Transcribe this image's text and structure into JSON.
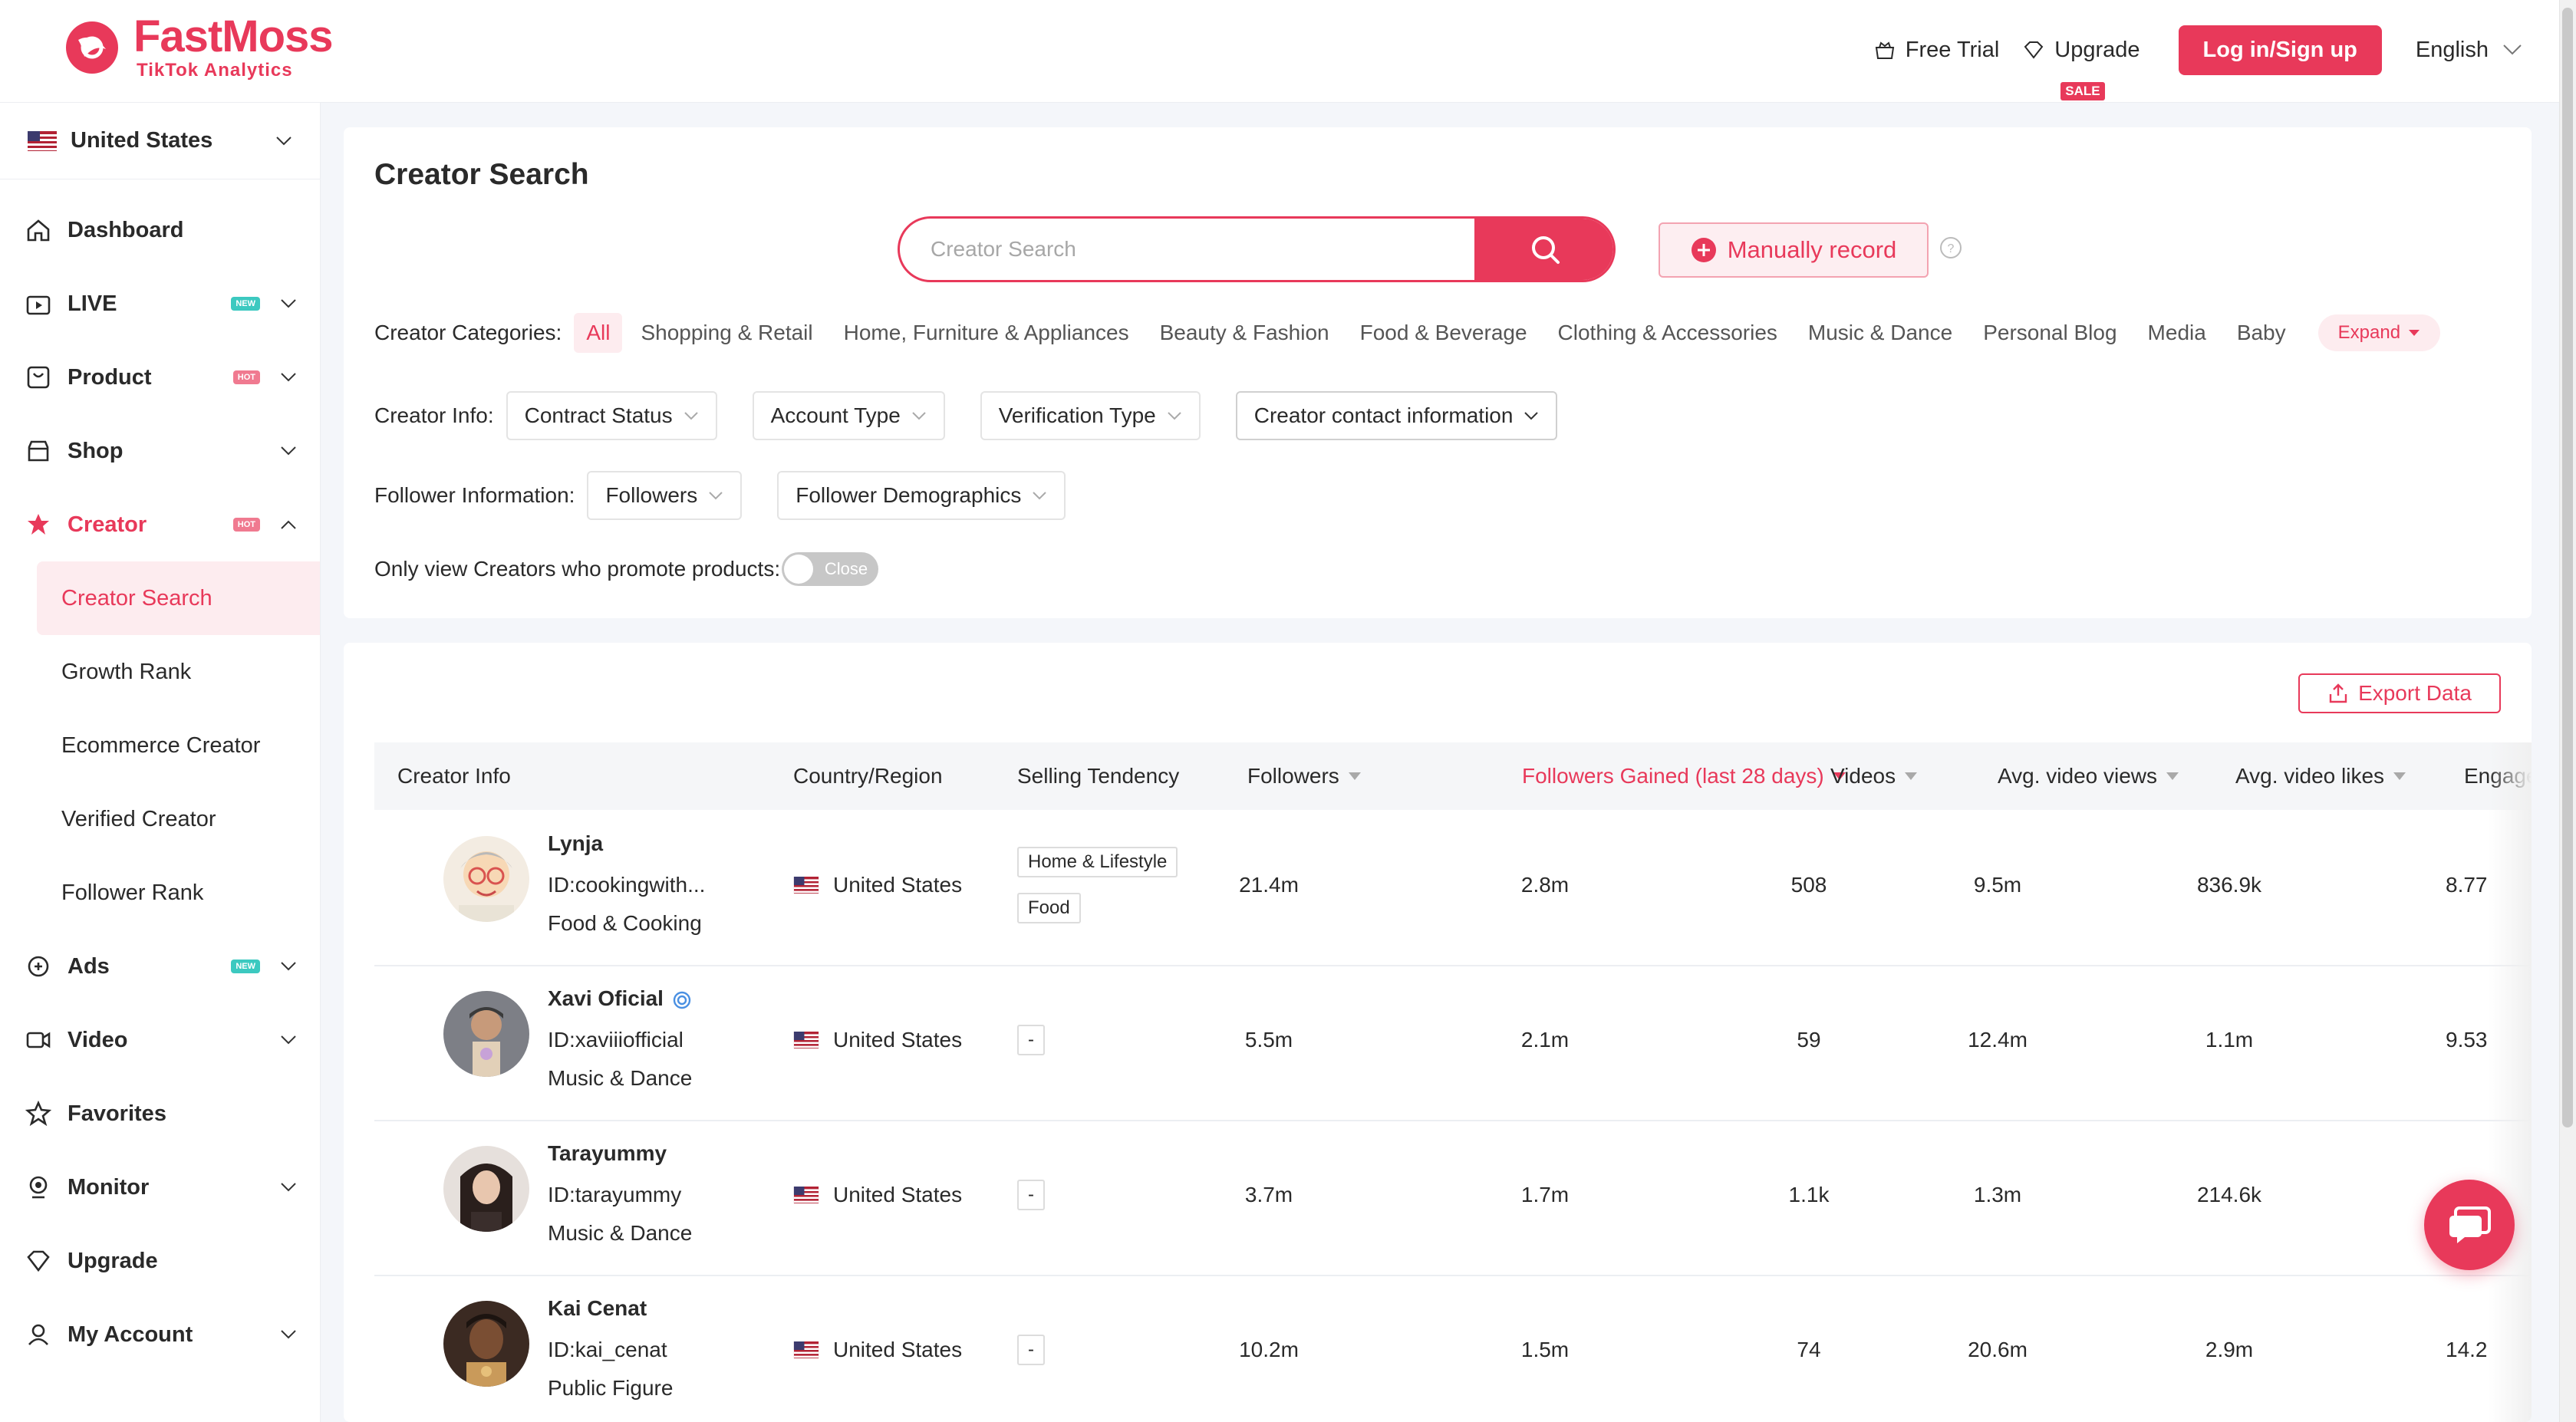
{
  "brand": {
    "name": "FastMoss",
    "subtitle": "TikTok Analytics",
    "color": "#e8395a"
  },
  "header": {
    "free_trial": "Free Trial",
    "upgrade": "Upgrade",
    "sale": "SALE",
    "login": "Log in/Sign up",
    "language": "English"
  },
  "sidebar": {
    "country": "United States",
    "items": [
      {
        "label": "Dashboard",
        "icon": "home-icon"
      },
      {
        "label": "LIVE",
        "icon": "live-icon",
        "badge": "NEW"
      },
      {
        "label": "Product",
        "icon": "product-icon",
        "badge": "HOT"
      },
      {
        "label": "Shop",
        "icon": "shop-icon"
      },
      {
        "label": "Creator",
        "icon": "creator-icon",
        "badge": "HOT"
      },
      {
        "label": "Ads",
        "icon": "ads-icon",
        "badge": "NEW"
      },
      {
        "label": "Video",
        "icon": "video-icon"
      },
      {
        "label": "Favorites",
        "icon": "star-icon"
      },
      {
        "label": "Monitor",
        "icon": "monitor-icon"
      },
      {
        "label": "Upgrade",
        "icon": "diamond-icon"
      },
      {
        "label": "My Account",
        "icon": "account-icon"
      }
    ],
    "creator_sub": [
      "Creator Search",
      "Growth Rank",
      "Ecommerce Creator",
      "Verified Creator",
      "Follower Rank"
    ]
  },
  "search": {
    "title": "Creator Search",
    "placeholder": "Creator Search",
    "manual_record": "Manually record"
  },
  "filters": {
    "categories_label": "Creator Categories:",
    "categories": [
      "All",
      "Shopping & Retail",
      "Home, Furniture & Appliances",
      "Beauty & Fashion",
      "Food & Beverage",
      "Clothing & Accessories",
      "Music & Dance",
      "Personal Blog",
      "Media",
      "Baby"
    ],
    "expand": "Expand",
    "info_label": "Creator Info:",
    "info_dropdowns": [
      "Contract Status",
      "Account Type",
      "Verification Type",
      "Creator contact information"
    ],
    "follower_label": "Follower Information:",
    "follower_dropdowns": [
      "Followers",
      "Follower Demographics"
    ],
    "promote_label": "Only view Creators who promote products:",
    "toggle_state": "Close"
  },
  "table": {
    "export": "Export Data",
    "columns": [
      "Creator Info",
      "Country/Region",
      "Selling Tendency",
      "Followers",
      "Followers Gained (last 28 days)",
      "Videos",
      "Avg. video views",
      "Avg. video likes",
      "Engageme"
    ],
    "rows": [
      {
        "name": "Lynja",
        "id": "ID:cookingwith...",
        "category": "Food & Cooking",
        "country": "United States",
        "tags": [
          "Home & Lifestyle",
          "Food"
        ],
        "followers": "21.4m",
        "gained": "2.8m",
        "videos": "508",
        "views": "9.5m",
        "likes": "836.9k",
        "engagement": "8.77"
      },
      {
        "name": "Xavi Oficial",
        "id": "ID:xaviiiofficial",
        "category": "Music & Dance",
        "country": "United States",
        "tags": [
          "-"
        ],
        "followers": "5.5m",
        "gained": "2.1m",
        "videos": "59",
        "views": "12.4m",
        "likes": "1.1m",
        "engagement": "9.53"
      },
      {
        "name": "Tarayummy",
        "id": "ID:tarayummy",
        "category": "Music & Dance",
        "country": "United States",
        "tags": [
          "-"
        ],
        "followers": "3.7m",
        "gained": "1.7m",
        "videos": "1.1k",
        "views": "1.3m",
        "likes": "214.6k",
        "engagement": ""
      },
      {
        "name": "Kai Cenat",
        "id": "ID:kai_cenat",
        "category": "Public Figure",
        "country": "United States",
        "tags": [
          "-"
        ],
        "followers": "10.2m",
        "gained": "1.5m",
        "videos": "74",
        "views": "20.6m",
        "likes": "2.9m",
        "engagement": "14.2"
      }
    ]
  }
}
